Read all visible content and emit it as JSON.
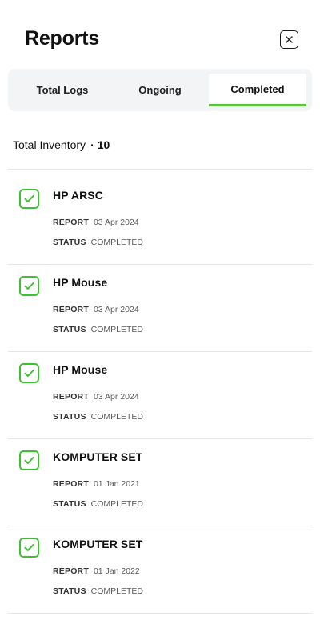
{
  "header": {
    "title": "Reports",
    "close_icon": "close-icon"
  },
  "tabs": [
    {
      "label": "Total Logs",
      "active": false
    },
    {
      "label": "Ongoing",
      "active": false
    },
    {
      "label": "Completed",
      "active": true
    }
  ],
  "summary": {
    "label": "Total Inventory",
    "separator": "·",
    "count": "10"
  },
  "list": {
    "report_key": "REPORT",
    "status_key": "STATUS",
    "items": [
      {
        "title": "HP ARSC",
        "report_date": "03 Apr 2024",
        "status": "COMPLETED"
      },
      {
        "title": "HP Mouse",
        "report_date": "03 Apr 2024",
        "status": "COMPLETED"
      },
      {
        "title": "HP Mouse",
        "report_date": "03 Apr 2024",
        "status": "COMPLETED"
      },
      {
        "title": "KOMPUTER SET",
        "report_date": "01 Jan 2021",
        "status": "COMPLETED"
      },
      {
        "title": "KOMPUTER SET",
        "report_date": "01 Jan 2022",
        "status": "COMPLETED"
      }
    ]
  },
  "colors": {
    "accent_green": "#5ac53a",
    "check_green": "#3cc22e",
    "tab_bg": "#f3f4f6"
  }
}
